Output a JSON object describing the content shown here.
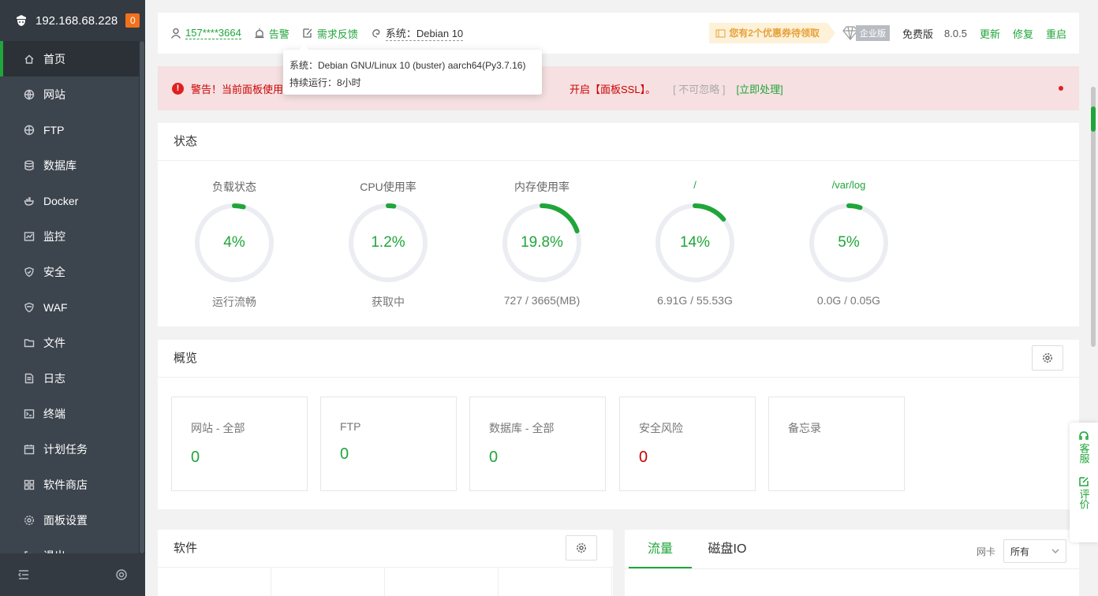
{
  "sidebar": {
    "ip": "192.168.68.228",
    "badge": "0",
    "items": [
      {
        "label": "首页",
        "icon": "home-icon"
      },
      {
        "label": "网站",
        "icon": "globe-icon"
      },
      {
        "label": "FTP",
        "icon": "ftp-globe-icon"
      },
      {
        "label": "数据库",
        "icon": "database-icon"
      },
      {
        "label": "Docker",
        "icon": "docker-icon"
      },
      {
        "label": "监控",
        "icon": "monitor-chart-icon"
      },
      {
        "label": "安全",
        "icon": "shield-icon"
      },
      {
        "label": "WAF",
        "icon": "waf-shield-icon"
      },
      {
        "label": "文件",
        "icon": "folder-icon"
      },
      {
        "label": "日志",
        "icon": "log-document-icon"
      },
      {
        "label": "终端",
        "icon": "terminal-icon"
      },
      {
        "label": "计划任务",
        "icon": "calendar-icon"
      },
      {
        "label": "软件商店",
        "icon": "grid-apps-icon"
      },
      {
        "label": "面板设置",
        "icon": "settings-icon"
      },
      {
        "label": "退出",
        "icon": "logout-icon"
      }
    ]
  },
  "topbar": {
    "user": "157****3664",
    "alarm": "告警",
    "feedback": "需求反馈",
    "system": "系统：Debian 10",
    "coupon": "您有2个优惠券待领取",
    "enterprise": "企业版",
    "free": "免费版",
    "version": "8.0.5",
    "update": "更新",
    "repair": "修复",
    "restart": "重启"
  },
  "tooltip": {
    "line1": "系统：Debian GNU/Linux 10 (buster) aarch64(Py3.7.16)",
    "line2": "持续运行：8小时"
  },
  "alert": {
    "text_start": "警告！当前面板使用",
    "text_end": "开启【面板SSL】。",
    "ignore": "[ 不可忽略 ]",
    "fix": "[立即处理]"
  },
  "status": {
    "title": "状态",
    "gauges": [
      {
        "label": "负载状态",
        "value": "4%",
        "percent": 4,
        "sub": "运行流畅"
      },
      {
        "label": "CPU使用率",
        "value": "1.2%",
        "percent": 1.2,
        "sub": "获取中"
      },
      {
        "label": "内存使用率",
        "value": "19.8%",
        "percent": 19.8,
        "sub": "727 / 3665(MB)"
      },
      {
        "label": "/",
        "value": "14%",
        "percent": 14,
        "sub": "6.91G / 55.53G"
      },
      {
        "label": "/var/log",
        "value": "5%",
        "percent": 5,
        "sub": "0.0G / 0.05G"
      }
    ]
  },
  "overview": {
    "title": "概览",
    "cards": [
      {
        "title": "网站 - 全部",
        "value": "0"
      },
      {
        "title": "FTP",
        "value": "0"
      },
      {
        "title": "数据库 - 全部",
        "value": "0"
      },
      {
        "title": "安全风险",
        "value": "0"
      },
      {
        "title": "备忘录",
        "value": ""
      }
    ]
  },
  "software": {
    "title": "软件"
  },
  "traffic": {
    "tabs": [
      "流量",
      "磁盘IO"
    ],
    "nic_label": "网卡",
    "nic_value": "所有"
  },
  "float": {
    "service": "客服",
    "review": "评价"
  },
  "colors": {
    "accent": "#20a53a",
    "danger": "#cc0000",
    "sidebar": "#3c444d"
  }
}
